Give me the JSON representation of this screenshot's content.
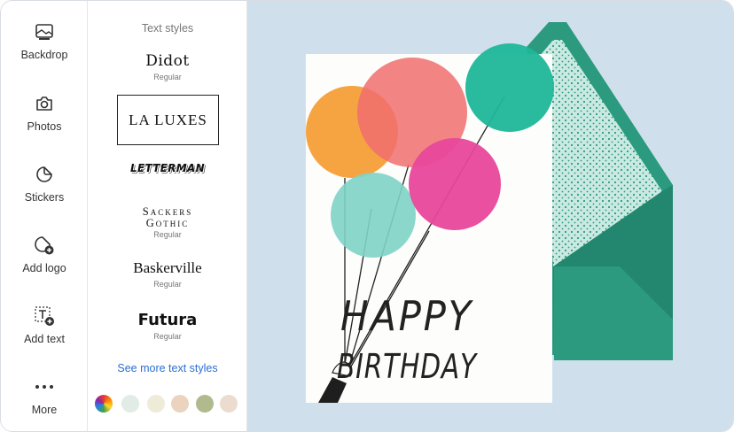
{
  "rail": {
    "items": [
      {
        "label": "Backdrop",
        "icon": "backdrop-icon"
      },
      {
        "label": "Photos",
        "icon": "camera-icon"
      },
      {
        "label": "Stickers",
        "icon": "sticker-icon"
      },
      {
        "label": "Add logo",
        "icon": "add-logo-icon"
      },
      {
        "label": "Add text",
        "icon": "add-text-icon"
      },
      {
        "label": "More",
        "icon": "more-dots-icon"
      }
    ]
  },
  "panel": {
    "title": "Text styles",
    "fonts": [
      {
        "name": "Didot",
        "sub": "Regular"
      },
      {
        "name": "LA LUXES",
        "sub": "",
        "selected": true
      },
      {
        "name": "LETTERMAN",
        "sub": ""
      },
      {
        "name": "Sackers Gothic",
        "sub": "Regular"
      },
      {
        "name": "Baskerville",
        "sub": "Regular"
      },
      {
        "name": "Futura",
        "sub": "Regular"
      }
    ],
    "see_more": "See more text styles",
    "swatches": [
      "multicolor",
      "#e1ece6",
      "#eeecd9",
      "#ecd3bf",
      "#b1b98f",
      "#ebdccf"
    ]
  },
  "card": {
    "line1": "HAPPY",
    "line2": "BIRTHDAY",
    "colors": {
      "orange": "#f59a2d",
      "coral": "#f06f6f",
      "teal": "#1fb79a",
      "pink": "#e8479a",
      "mint": "#7fd3c6",
      "envelope": "#2b9a7e",
      "liner": "#a9d8cd",
      "backdrop": "#cfe0ec"
    }
  }
}
